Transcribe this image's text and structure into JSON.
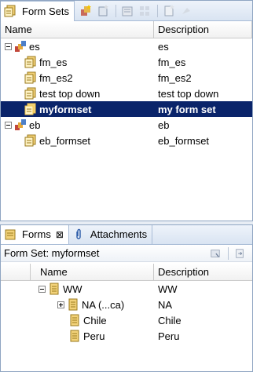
{
  "top_view": {
    "tab_label": "Form Sets",
    "columns": [
      "Name",
      "Description"
    ],
    "rows": [
      {
        "name": "es",
        "desc": "es",
        "level": 0,
        "toggle": "minus",
        "icon": "group-icon"
      },
      {
        "name": "fm_es",
        "desc": "fm_es",
        "level": 1,
        "toggle": "",
        "icon": "formset-icon"
      },
      {
        "name": "fm_es2",
        "desc": "fm_es2",
        "level": 1,
        "toggle": "",
        "icon": "formset-icon"
      },
      {
        "name": "test top down",
        "desc": "test top down",
        "level": 1,
        "toggle": "",
        "icon": "formset-icon"
      },
      {
        "name": "myformset",
        "desc": "my form set",
        "level": 1,
        "toggle": "",
        "icon": "formset-icon",
        "selected": true
      },
      {
        "name": "eb",
        "desc": "eb",
        "level": 0,
        "toggle": "minus",
        "icon": "group-icon"
      },
      {
        "name": "eb_formset",
        "desc": "eb_formset",
        "level": 1,
        "toggle": "",
        "icon": "formset-icon"
      }
    ]
  },
  "bottom_view": {
    "tabs": [
      {
        "label": "Forms",
        "active": true,
        "has_close": true
      },
      {
        "label": "Attachments",
        "active": false
      }
    ],
    "formset_label": "Form Set: myformset",
    "columns": [
      "Name",
      "Description"
    ],
    "rows": [
      {
        "name": "WW",
        "desc": "WW",
        "level": 0,
        "toggle": "minus"
      },
      {
        "name": "NA (...ca)",
        "desc": "NA",
        "level": 1,
        "toggle": "plus"
      },
      {
        "name": "Chile",
        "desc": "Chile",
        "level": 1,
        "toggle": ""
      },
      {
        "name": "Peru",
        "desc": "Peru",
        "level": 1,
        "toggle": ""
      }
    ]
  },
  "colors": {
    "selection": "#0a246a",
    "border": "#8fa5c2",
    "tab_gradient_top": "#eef3fa"
  }
}
